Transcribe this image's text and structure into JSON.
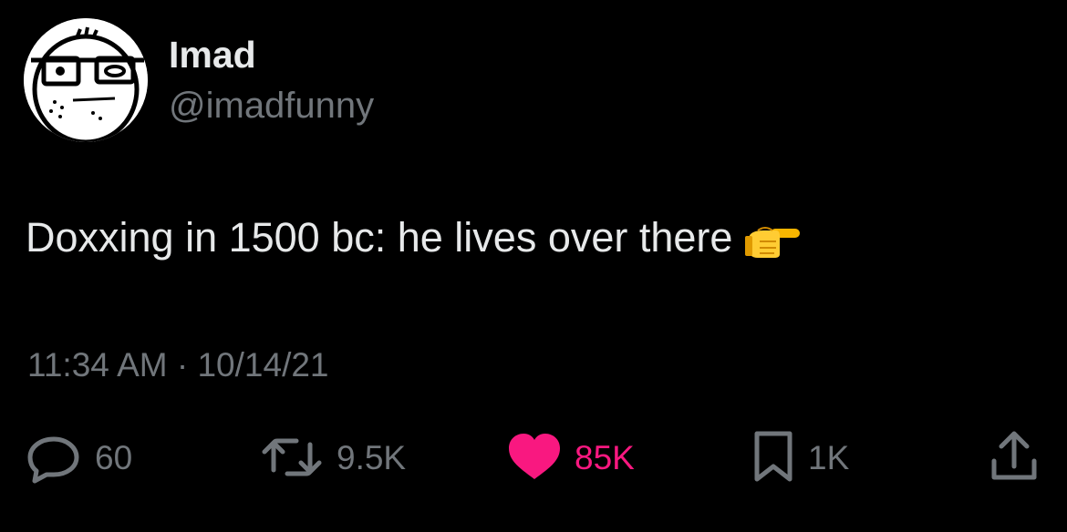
{
  "author": {
    "display_name": "Imad",
    "handle": "@imadfunny",
    "avatar_icon": "cartoon-face-avatar"
  },
  "tweet": {
    "text": "Doxxing in 1500 bc: he lives over there",
    "emoji": "pointing-right-hand-emoji"
  },
  "timestamp": {
    "time": "11:34 AM",
    "separator": "·",
    "date": "10/14/21"
  },
  "actions": {
    "reply": {
      "icon": "reply-icon",
      "count": "60"
    },
    "retweet": {
      "icon": "retweet-icon",
      "count": "9.5K"
    },
    "like": {
      "icon": "heart-icon",
      "count": "85K",
      "active": true
    },
    "bookmark": {
      "icon": "bookmark-icon",
      "count": "1K"
    },
    "share": {
      "icon": "share-icon"
    }
  },
  "colors": {
    "background": "#000000",
    "primary_text": "#e7e9ea",
    "secondary_text": "#71767b",
    "like_active": "#f91880"
  }
}
